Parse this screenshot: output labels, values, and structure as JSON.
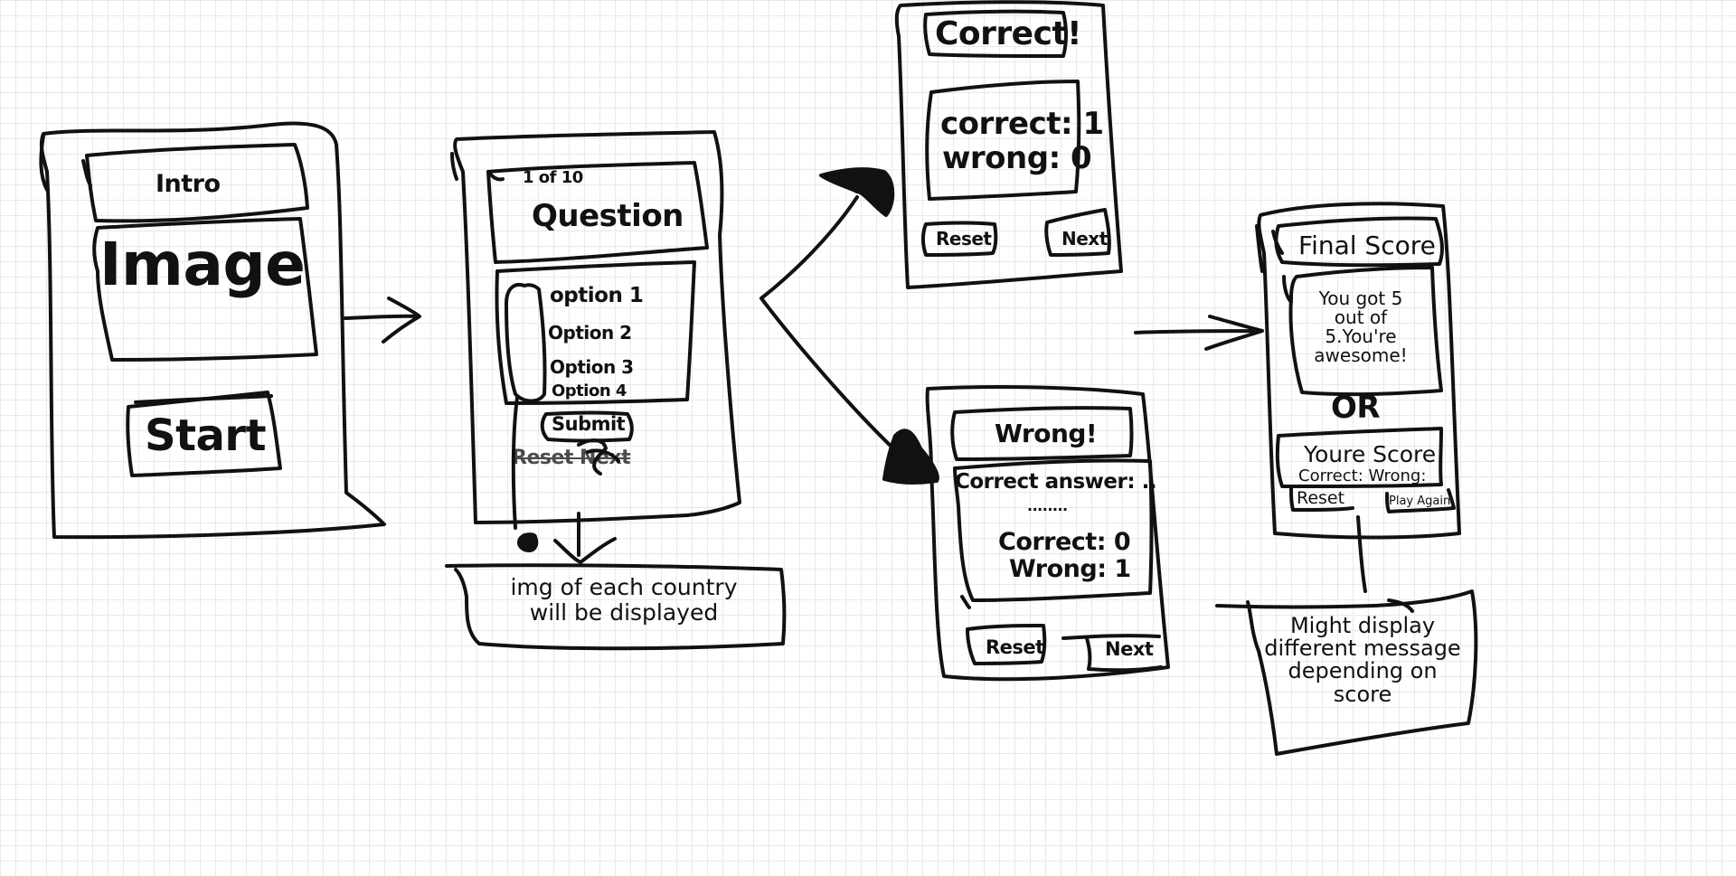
{
  "intro": {
    "title": "Intro",
    "image": "Image",
    "start": "Start"
  },
  "question": {
    "counter": "1 of 10",
    "title": "Question",
    "options": [
      "option 1",
      "Option 2",
      "Option 3",
      "Option 4"
    ],
    "submit": "Submit",
    "crossed_out": "Reset Next"
  },
  "note_image": {
    "line1": "img of each country",
    "line2": "will be displayed"
  },
  "correct": {
    "title": "Correct!",
    "line1": "correct: 1",
    "line2": "wrong: 0",
    "reset": "Reset",
    "next": "Next"
  },
  "wrong": {
    "title": "Wrong!",
    "answer": "Correct answer: ..",
    "dots": "........",
    "line1": "Correct: 0",
    "line2": "Wrong: 1",
    "reset": "Reset",
    "next": "Next"
  },
  "final": {
    "title": "Final Score",
    "msg1": "You got 5",
    "msg2": "out of",
    "msg3": "5.You're",
    "msg4": "awesome!",
    "or": "OR",
    "score_title": "Youre Score",
    "score_line": "Correct: Wrong:",
    "reset": "Reset",
    "play_again": "Play Again"
  },
  "note_message": {
    "line1": "Might display",
    "line2": "different message",
    "line3": "depending on",
    "line4": "score"
  }
}
